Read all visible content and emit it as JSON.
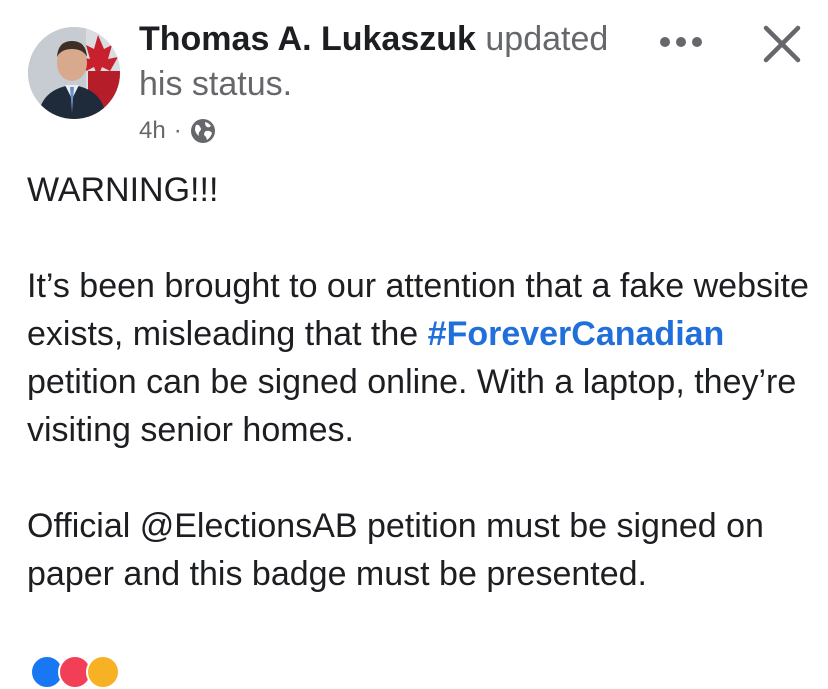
{
  "post": {
    "author": "Thomas A. Lukaszuk",
    "action_line1": " updated",
    "action_line2": "his status.",
    "time": "4h",
    "separator": "·",
    "privacy_icon": "globe-icon",
    "paragraphs": {
      "warning": "WARNING!!!",
      "p2_before": "It’s been brought to our attention that a fake website exists, misleading that the ",
      "hashtag": "#ForeverCanadian",
      "p2_after": " petition can be signed online. With a laptop, they’re visiting senior homes.",
      "p3": "Official @ElectionsAB petition must be signed on paper and this badge must be presented."
    }
  },
  "icons": {
    "more": "more-horizontal-icon",
    "close": "close-icon"
  },
  "colors": {
    "author": "#1c1e21",
    "secondary": "#65676b",
    "hashtag": "#216fdb",
    "reaction_like": "#1877f2",
    "reaction_love": "#f33e58",
    "reaction_care": "#f7b125"
  }
}
